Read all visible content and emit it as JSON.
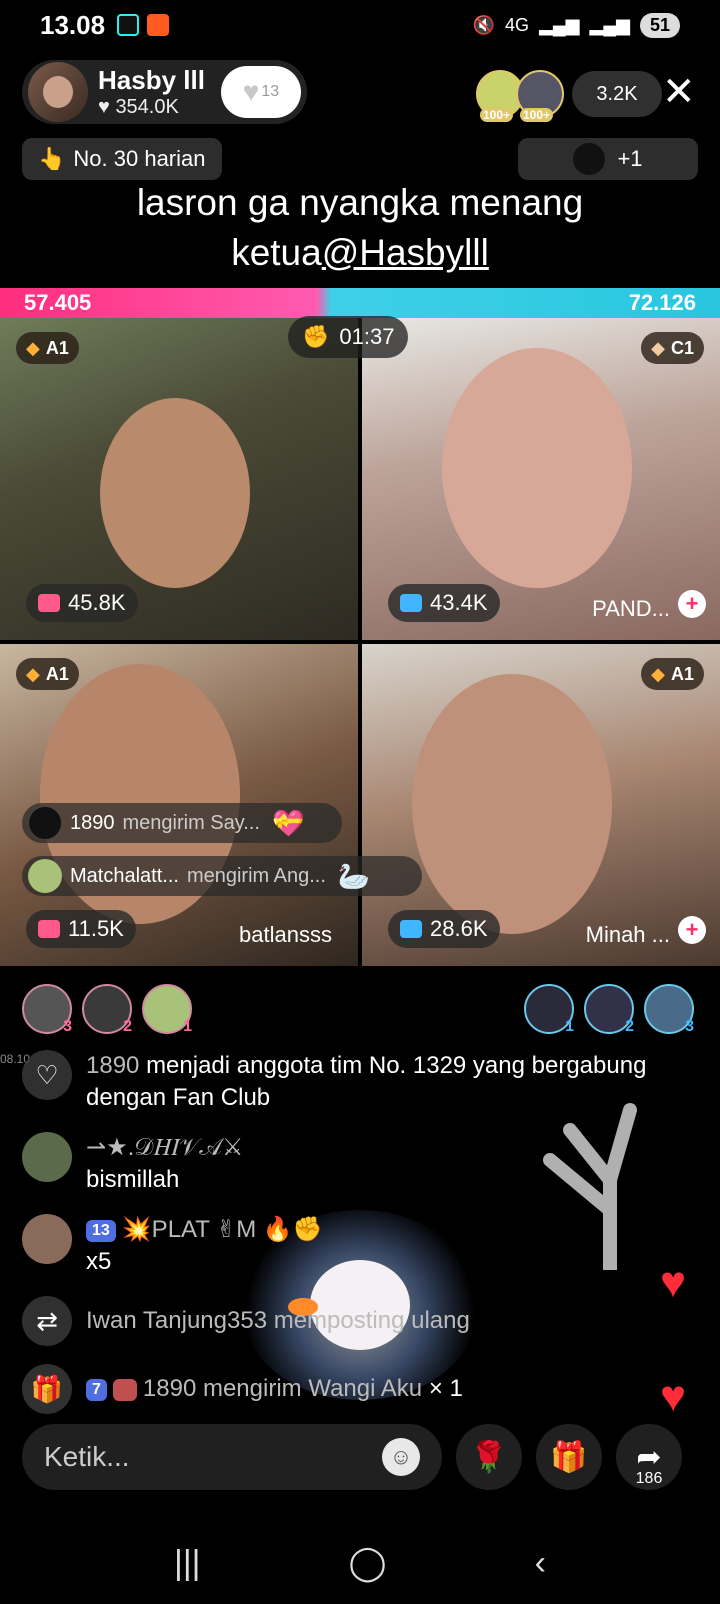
{
  "status_bar": {
    "time": "13.08",
    "network": "4G",
    "battery": "51"
  },
  "host": {
    "name": "Hasby lll",
    "likes": "354.0K",
    "follow_count": "13"
  },
  "top_viewers": [
    {
      "level": "100+"
    },
    {
      "level": "100+"
    }
  ],
  "viewer_count": "3.2K",
  "rank_label": "No. 30 harian",
  "extra_label": "+1",
  "caption": {
    "line1": "lasron ga nyangka menang",
    "line2_prefix": "ketua",
    "mention": "@Hasbylll"
  },
  "battle": {
    "left_score": "57.405",
    "right_score": "72.126",
    "timer": "01:37"
  },
  "tiles": [
    {
      "rank": "A1",
      "score": "45.8K",
      "name": "",
      "cam_color": "#ff5a8a"
    },
    {
      "rank": "C1",
      "score": "43.4K",
      "name": "PAND...",
      "cam_color": "#3fb6ff"
    },
    {
      "rank": "A1",
      "score": "11.5K",
      "name": "batlansss",
      "cam_color": "#ff5a8a"
    },
    {
      "rank": "A1",
      "score": "28.6K",
      "name": "Minah ...",
      "cam_color": "#3fb6ff"
    }
  ],
  "gift_toasts": [
    {
      "user": "1890",
      "text": "mengirim Say..."
    },
    {
      "user": "Matchalatt...",
      "text": "mengirim Ang..."
    }
  ],
  "supporters_left": [
    {
      "n": "3"
    },
    {
      "n": "2"
    },
    {
      "n": "1"
    }
  ],
  "supporters_right": [
    {
      "n": "1"
    },
    {
      "n": "2"
    },
    {
      "n": "3"
    }
  ],
  "time_stamp": "08.10",
  "chat": [
    {
      "type": "system",
      "user": "1890",
      "text": "menjadi anggota tim No. 1329 yang bergabung dengan Fan Club"
    },
    {
      "type": "message",
      "user": "⇀★.𝒟𝐻𝐼𝒱𝒜⚔",
      "text": "bismillah"
    },
    {
      "type": "message",
      "level": "13",
      "user": "💥PLAT ✌M 🔥✊",
      "text": "x5"
    },
    {
      "type": "repost",
      "user": "Iwan Tanjung353",
      "text": "memposting ulang"
    },
    {
      "type": "gift",
      "level": "7",
      "user": "1890",
      "text": "mengirim Wangi Aku",
      "count": "× 1"
    }
  ],
  "input": {
    "placeholder": "Ketik..."
  },
  "share_count": "186",
  "colors": {
    "battle_left": "#ff2e7e",
    "battle_right": "#29c6e0",
    "heart": "#ff2c3a"
  }
}
